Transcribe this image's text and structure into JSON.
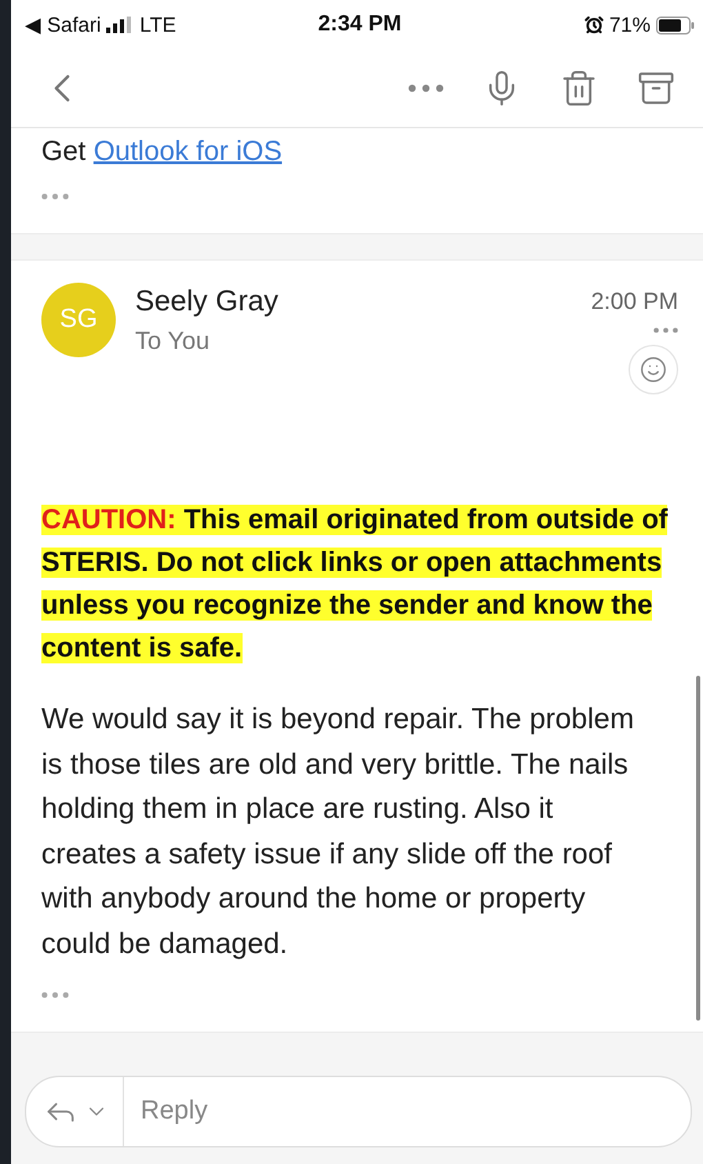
{
  "status_bar": {
    "back_app": "◀ Safari",
    "network": "LTE",
    "time": "2:34 PM",
    "battery": "71%"
  },
  "previous_message": {
    "prefix": "Get",
    "link": "Outlook for iOS"
  },
  "message": {
    "avatar_initials": "SG",
    "sender": "Seely Gray",
    "recipient": "To You",
    "time": "2:00 PM",
    "caution": {
      "label": "CAUTION:",
      "text": "This email originated from outside of STERIS. Do not click links or open attachments unless you recognize the sender and know the content is safe."
    },
    "body": "We would say it is beyond repair. The problem is those tiles are old and very brittle. The nails holding them in place are rusting. Also it creates a safety issue if any slide off the roof with anybody around the home or property could be damaged."
  },
  "reply_bar": {
    "placeholder": "Reply"
  }
}
